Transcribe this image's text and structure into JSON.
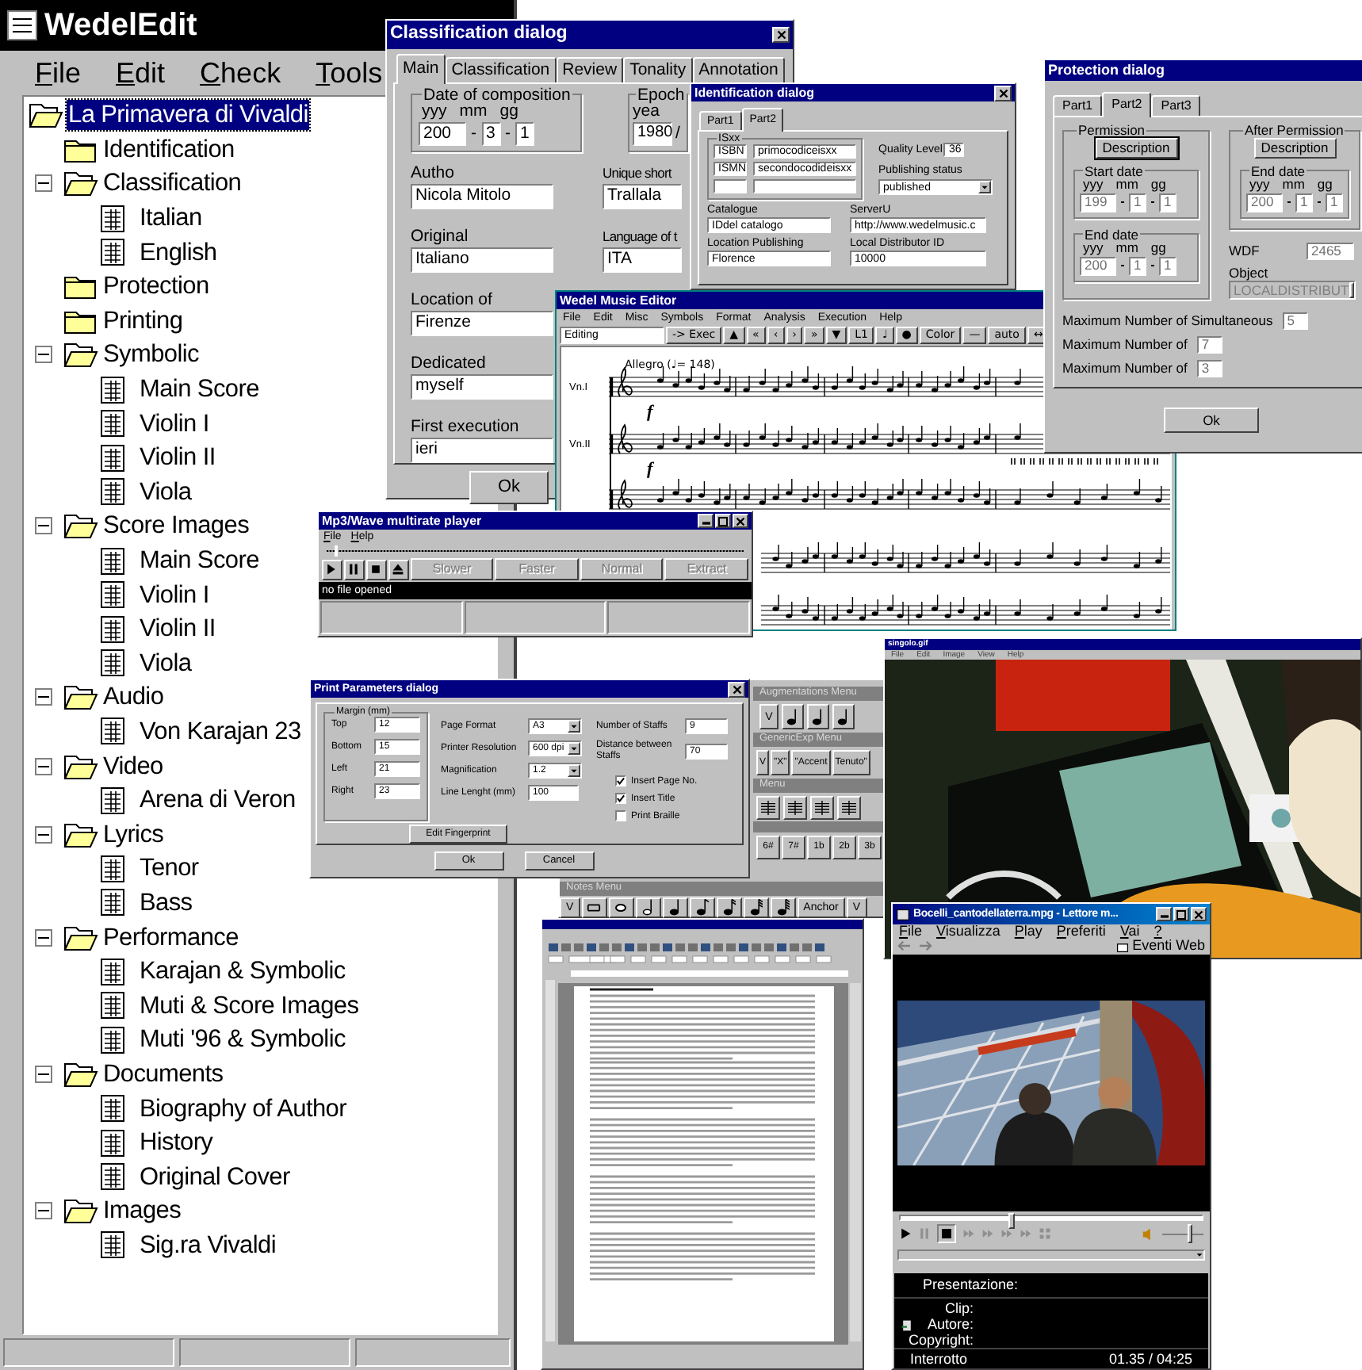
{
  "tree_window": {
    "title": "WedelEdit",
    "menu": [
      "File",
      "Edit",
      "Check",
      "Tools"
    ],
    "tree": [
      {
        "label": "La Primavera di Vivaldi",
        "kind": "folder",
        "expanded": true,
        "selected": true,
        "children": [
          {
            "label": "Identification",
            "kind": "folder",
            "selected": false
          },
          {
            "label": "Classification",
            "kind": "folder",
            "expanded": true,
            "selected": false,
            "children": [
              {
                "label": "Italian",
                "kind": "document",
                "selected": false
              },
              {
                "label": "English",
                "kind": "document",
                "selected": false
              }
            ]
          },
          {
            "label": "Protection",
            "kind": "folder",
            "selected": false
          },
          {
            "label": "Printing",
            "kind": "folder",
            "selected": false
          },
          {
            "label": "Symbolic",
            "kind": "folder",
            "expanded": true,
            "selected": false,
            "children": [
              {
                "label": "Main Score",
                "kind": "document",
                "selected": false
              },
              {
                "label": "Violin I",
                "kind": "document",
                "selected": false
              },
              {
                "label": "Violin II",
                "kind": "document",
                "selected": false
              },
              {
                "label": "Viola",
                "kind": "document",
                "selected": false
              }
            ]
          },
          {
            "label": "Score Images",
            "kind": "folder",
            "expanded": true,
            "selected": false,
            "children": [
              {
                "label": "Main Score",
                "kind": "document",
                "selected": false
              },
              {
                "label": "Violin I",
                "kind": "document",
                "selected": false
              },
              {
                "label": "Violin II",
                "kind": "document",
                "selected": false
              },
              {
                "label": "Viola",
                "kind": "document",
                "selected": false
              }
            ]
          },
          {
            "label": "Audio",
            "kind": "folder",
            "expanded": true,
            "selected": false,
            "children": [
              {
                "label": "Von Karajan 23",
                "kind": "document",
                "selected": false
              }
            ]
          },
          {
            "label": "Video",
            "kind": "folder",
            "expanded": true,
            "selected": false,
            "children": [
              {
                "label": "Arena di Veron",
                "kind": "document",
                "selected": false
              }
            ]
          },
          {
            "label": "Lyrics",
            "kind": "folder",
            "expanded": true,
            "selected": false,
            "children": [
              {
                "label": "Tenor",
                "kind": "document",
                "selected": false
              },
              {
                "label": "Bass",
                "kind": "document",
                "selected": false
              }
            ]
          },
          {
            "label": "Performance",
            "kind": "folder",
            "expanded": true,
            "selected": false,
            "children": [
              {
                "label": "Karajan & Symbolic",
                "kind": "document",
                "selected": false
              },
              {
                "label": "Muti & Score Images",
                "kind": "document",
                "selected": false
              },
              {
                "label": "Muti '96 & Symbolic",
                "kind": "document",
                "selected": false
              }
            ]
          },
          {
            "label": "Documents",
            "kind": "folder",
            "expanded": true,
            "selected": false,
            "children": [
              {
                "label": "Biography of Author",
                "kind": "document",
                "selected": false
              },
              {
                "label": "History",
                "kind": "document",
                "selected": false
              },
              {
                "label": "Original Cover",
                "kind": "document",
                "selected": false
              }
            ]
          },
          {
            "label": "Images",
            "kind": "folder",
            "expanded": true,
            "selected": false,
            "children": [
              {
                "label": "Sig.ra Vivaldi",
                "kind": "document",
                "selected": false
              }
            ]
          }
        ]
      }
    ]
  },
  "classification_dialog": {
    "title": "Classification dialog",
    "tabs": [
      {
        "label": "Main",
        "selected": true
      },
      {
        "label": "Classification",
        "selected": false
      },
      {
        "label": "Review",
        "selected": false
      },
      {
        "label": "Tonality",
        "selected": false
      },
      {
        "label": "Annotation",
        "selected": false
      }
    ],
    "date_group": {
      "title": "Date of composition",
      "columns": [
        "yyy",
        "mm",
        "gg"
      ],
      "values": [
        "200",
        "3",
        "1"
      ],
      "separator": "-"
    },
    "epoch_group": {
      "title": "Epoch",
      "column": "yea",
      "value": "1980",
      "separator": "/"
    },
    "left_fields": [
      {
        "label": "Autho",
        "value": "Nicola Mitolo"
      },
      {
        "label": "Original",
        "value": "Italiano"
      },
      {
        "label": "Location of",
        "value": "Firenze"
      },
      {
        "label": "Dedicated",
        "value": "myself"
      },
      {
        "label": "First execution",
        "value": "ieri"
      }
    ],
    "right_fields": [
      {
        "label": "Unique short",
        "value": "Trallala"
      },
      {
        "label": "Language of t",
        "value": "ITA"
      }
    ],
    "ok": "Ok"
  },
  "identification_dialog": {
    "title": "Identification dialog",
    "tabs": [
      {
        "label": "Part1",
        "selected": false
      },
      {
        "label": "Part2",
        "selected": true
      }
    ],
    "isxx": {
      "title": "ISxx",
      "rows": [
        {
          "type": "ISBN",
          "code": "primocodiceisxx"
        },
        {
          "type": "ISMN",
          "code": "secondocodideisxx"
        }
      ]
    },
    "quality_level": {
      "label": "Quality Level",
      "value": "36"
    },
    "publishing_status": {
      "label": "Publishing status",
      "value": "published"
    },
    "catalogue": {
      "label": "Catalogue",
      "value": "IDdel catalogo"
    },
    "server": {
      "label": "ServerU",
      "value": "http://www.wedelmusic.c"
    },
    "location_publishing": {
      "label": "Location Publishing",
      "value": "Florence"
    },
    "distributor": {
      "label": "Local Distributor ID",
      "value": "10000"
    }
  },
  "music_editor": {
    "title": "Wedel Music Editor",
    "menu": [
      "File",
      "Edit",
      "Misc",
      "Symbols",
      "Format",
      "Analysis",
      "Execution",
      "Help"
    ],
    "mode": "Editing",
    "toolbar": [
      "-> Exec",
      "▲",
      "«",
      "‹",
      "›",
      "»",
      "▼",
      "L1",
      "♩",
      "●",
      "Color",
      "—",
      "auto",
      "↔"
    ],
    "tempo": "Allegro (♩= 148)",
    "staves": [
      {
        "label": "Vn.I",
        "dynamic": "f"
      },
      {
        "label": "Vn.II",
        "dynamic": "f"
      }
    ]
  },
  "protection_dialog": {
    "title": "Protection dialog",
    "tabs": [
      {
        "label": "Part1",
        "selected": false
      },
      {
        "label": "Part2",
        "selected": true
      },
      {
        "label": "Part3",
        "selected": false
      }
    ],
    "permission": {
      "title": "Permission",
      "button": "Description",
      "start_date": {
        "title": "Start date",
        "columns": [
          "yyy",
          "mm",
          "gg"
        ],
        "values": [
          "199",
          "1",
          "1"
        ]
      },
      "end_date": {
        "title": "End date",
        "columns": [
          "yyy",
          "mm",
          "gg"
        ],
        "values": [
          "200",
          "1",
          "1"
        ]
      }
    },
    "after_permission": {
      "title": "After Permission",
      "button": "Description",
      "end_date": {
        "title": "End date",
        "columns": [
          "yyy",
          "mm",
          "gg"
        ],
        "values": [
          "200",
          "1",
          "1"
        ]
      }
    },
    "wdf": {
      "label": "WDF",
      "value": "2465"
    },
    "object": {
      "label": "Object",
      "value": "LOCALDISTRIBUT",
      "disabled": true
    },
    "limits": [
      {
        "label": "Maximum Number of Simultaneous",
        "value": "5"
      },
      {
        "label": "Maximum Number of",
        "value": "7"
      },
      {
        "label": "Maximum Number of",
        "value": "3"
      }
    ],
    "ok": "Ok"
  },
  "palette": {
    "augmentations": {
      "title": "Augmentations Menu",
      "buttons": [
        "V"
      ]
    },
    "generic": {
      "title": "GenericExp Menu",
      "buttons": [
        "V",
        "\"X\"",
        "\"Accent",
        "Tenuto\""
      ]
    },
    "clefs": {
      "title": "Menu"
    },
    "accidentals": [
      "6#",
      "7#",
      "1b",
      "2b",
      "3b"
    ],
    "notes": {
      "title": "Notes Menu",
      "buttons": [
        {
          "kind": "text",
          "label": "V"
        },
        {
          "kind": "breve"
        },
        {
          "kind": "whole"
        },
        {
          "kind": "half"
        },
        {
          "kind": "quarter"
        },
        {
          "kind": "eighth"
        },
        {
          "kind": "sixteenth"
        },
        {
          "kind": "thirty-second"
        },
        {
          "kind": "sixty-fourth"
        },
        {
          "kind": "text",
          "label": "Anchor"
        },
        {
          "kind": "text",
          "label": "V"
        }
      ]
    }
  },
  "mp3_player": {
    "title": "Mp3/Wave multirate player",
    "menu": [
      "File",
      "Help"
    ],
    "position": {
      "level": 0.02
    },
    "buttons": [
      {
        "label": "Slower",
        "disabled": true
      },
      {
        "label": "Faster",
        "disabled": true
      },
      {
        "label": "Normal",
        "disabled": true
      },
      {
        "label": "Extract",
        "disabled": true
      }
    ],
    "status": "no file opened"
  },
  "print_dialog": {
    "title": "Print Parameters dialog",
    "margin": {
      "title": "Margin (mm)",
      "fields": [
        {
          "label": "Top",
          "value": "12"
        },
        {
          "label": "Bottom",
          "value": "15"
        },
        {
          "label": "Left",
          "value": "21"
        },
        {
          "label": "Right",
          "value": "23"
        }
      ]
    },
    "settings": [
      {
        "label": "Page Format",
        "value": "A3",
        "kind": "dropdown"
      },
      {
        "label": "Printer Resolution",
        "value": "600 dpi",
        "kind": "dropdown"
      },
      {
        "label": "Magnification",
        "value": "1.2",
        "kind": "dropdown"
      },
      {
        "label": "Line Lenght (mm)",
        "value": "100",
        "kind": "text"
      }
    ],
    "staffs": [
      {
        "label": "Number of Staffs",
        "value": "9"
      },
      {
        "label": "Distance between Staffs",
        "value": "70"
      }
    ],
    "options": [
      {
        "label": "Insert Page No.",
        "checked": true
      },
      {
        "label": "Insert Title",
        "checked": true
      },
      {
        "label": "Print Braille",
        "checked": false
      }
    ],
    "fingerprint_button": "Edit Fingerprint",
    "buttons": [
      "Ok",
      "Cancel"
    ]
  },
  "photo_window": {
    "title": "singolo.gif",
    "menu": [
      "File",
      "Edit",
      "Image",
      "View",
      "Help"
    ]
  },
  "media_player": {
    "title": "Bocelli_cantodellaterra.mpg - Lettore m...",
    "menu": [
      "File",
      "Visualizza",
      "Play",
      "Preferiti",
      "Vai",
      "?"
    ],
    "web_events": "Eventi Web",
    "seek": {
      "level": 0.36
    },
    "volume": {
      "level": 0.6
    },
    "info_heading": "Presentazione:",
    "info_labels": [
      "Clip:",
      "Autore:",
      "Copyright:"
    ],
    "status": "Interrotto",
    "time": "01.35 / 04:25"
  }
}
